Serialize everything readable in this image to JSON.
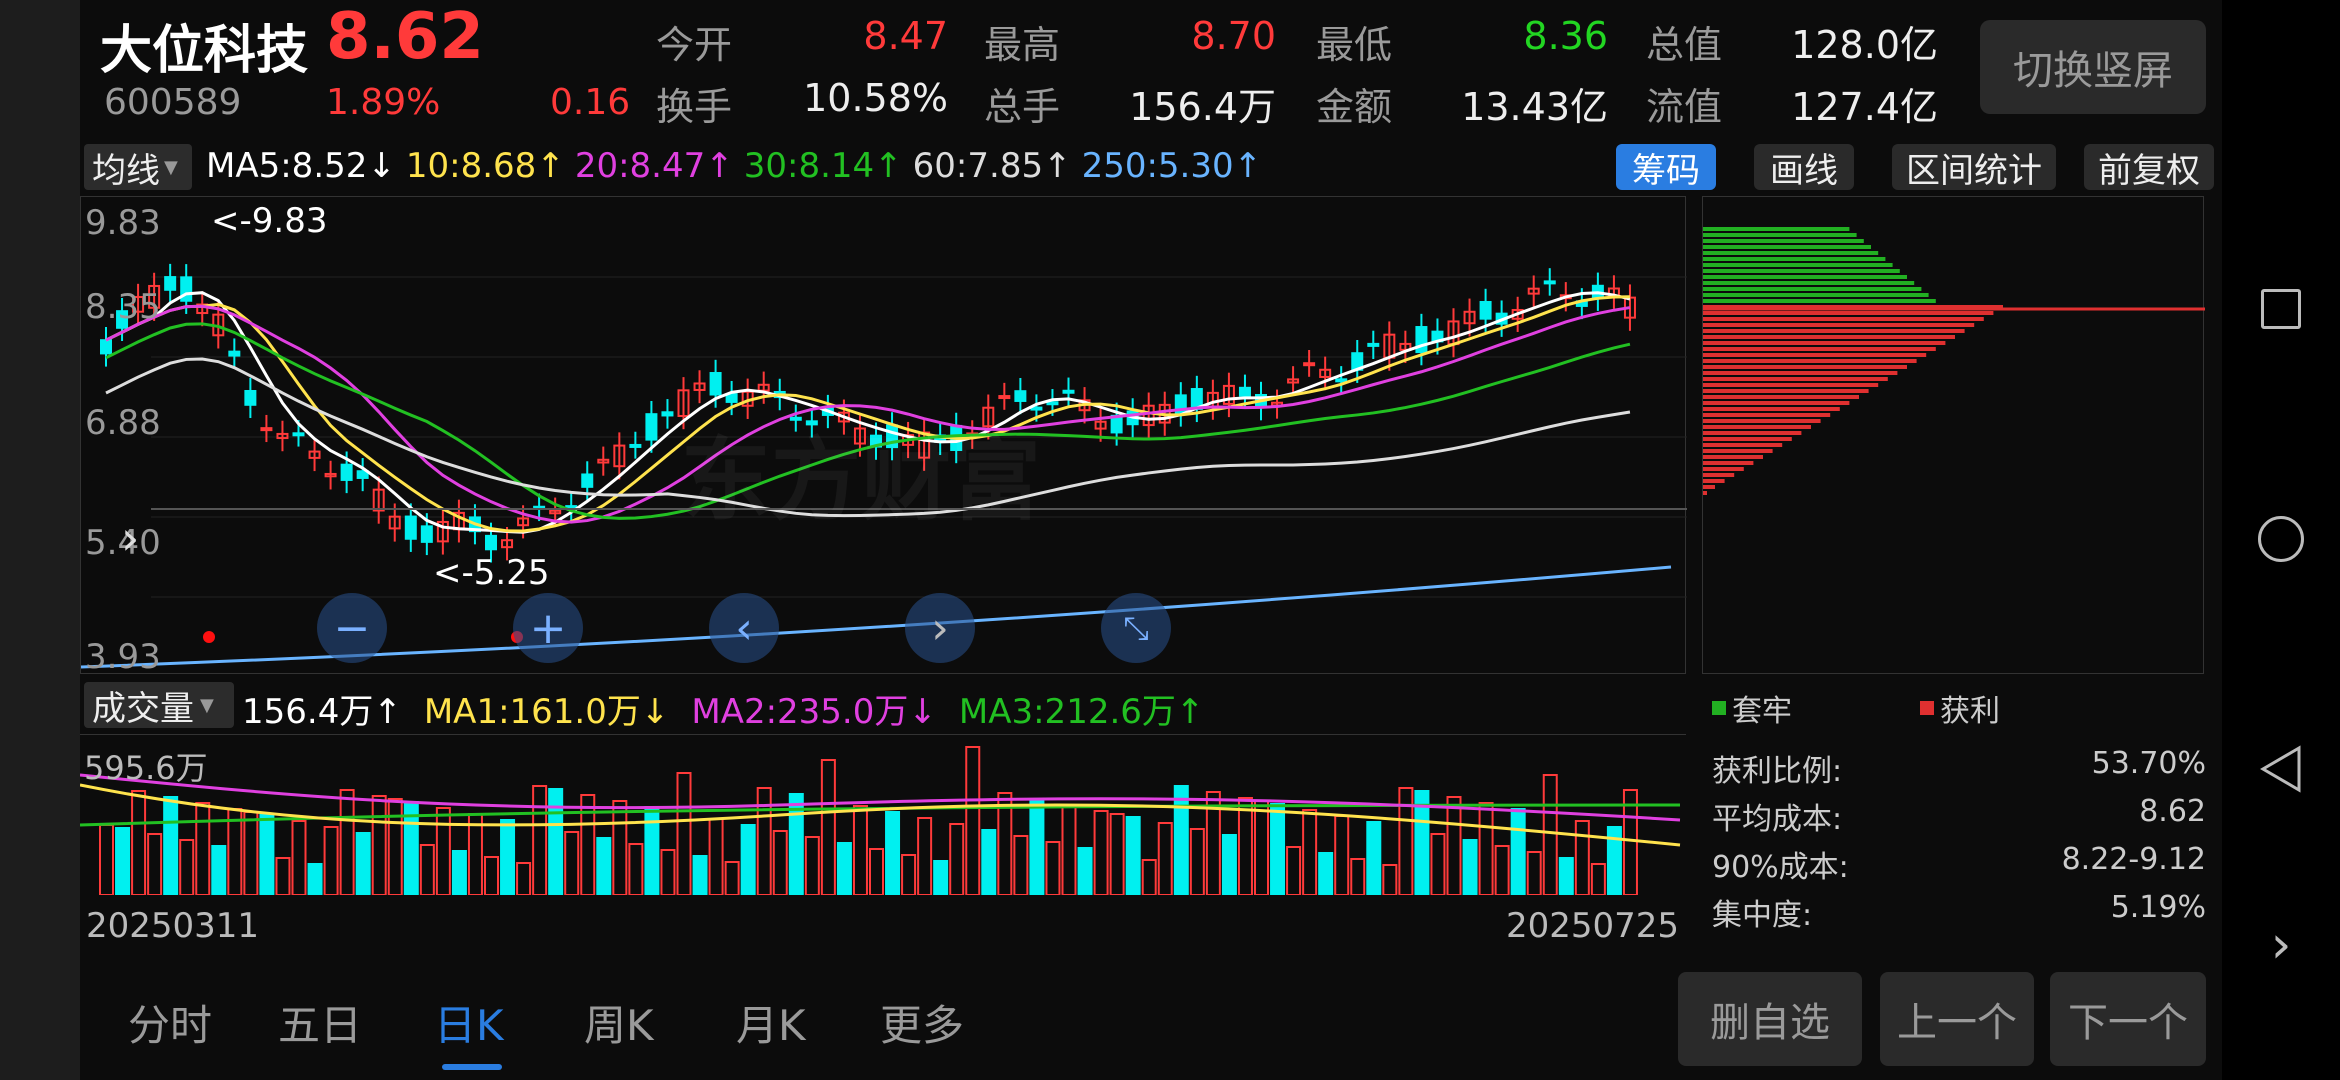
{
  "header": {
    "name": "大位科技",
    "price": "8.62",
    "code": "600589",
    "pct": "1.89%",
    "change": "0.16"
  },
  "stats": [
    {
      "label": "今开",
      "value": "8.47",
      "color": "red"
    },
    {
      "label": "最高",
      "value": "8.70",
      "color": "red"
    },
    {
      "label": "最低",
      "value": "8.36",
      "color": "green"
    },
    {
      "label": "总值",
      "value": "128.0亿",
      "color": "white"
    },
    {
      "label": "换手",
      "value": "10.58%",
      "color": "white"
    },
    {
      "label": "总手",
      "value": "156.4万",
      "color": "white"
    },
    {
      "label": "金额",
      "value": "13.43亿",
      "color": "white"
    },
    {
      "label": "流值",
      "value": "127.4亿",
      "color": "white"
    }
  ],
  "switch_label": "切换竖屏",
  "ma": {
    "selector": "均线",
    "items": [
      {
        "text": "MA5:8.52",
        "arrow": "↓",
        "color": "#ffffff"
      },
      {
        "text": "10:8.68",
        "arrow": "↑",
        "color": "#ffe34d"
      },
      {
        "text": "20:8.47",
        "arrow": "↑",
        "color": "#e040e0"
      },
      {
        "text": "30:8.14",
        "arrow": "↑",
        "color": "#22c022"
      },
      {
        "text": "60:7.85",
        "arrow": "↑",
        "color": "#dddddd"
      },
      {
        "text": "250:5.30",
        "arrow": "↑",
        "color": "#69b4ff"
      }
    ]
  },
  "tools": {
    "chips": "筹码",
    "draw": "画线",
    "range": "区间统计",
    "adjust": "前复权"
  },
  "kchart": {
    "yticks": [
      "9.83",
      "8.35",
      "6.88",
      "5.40",
      "3.93"
    ],
    "high_label": "<-9.83",
    "low_label": "<-5.25",
    "watermark": "东方财富"
  },
  "volume": {
    "selector": "成交量",
    "items": [
      {
        "text": "156.4万",
        "arrow": "↑",
        "color": "#ffffff"
      },
      {
        "text": "MA1:161.0万",
        "arrow": "↓",
        "color": "#ffe34d"
      },
      {
        "text": "MA2:235.0万",
        "arrow": "↓",
        "color": "#e040e0"
      },
      {
        "text": "MA3:212.6万",
        "arrow": "↑",
        "color": "#22c022"
      }
    ],
    "max_label": "595.6万",
    "date_start": "20250311",
    "date_end": "20250725"
  },
  "chips": {
    "legend_trapped": "套牢",
    "legend_profit": "获利",
    "rows": [
      {
        "label": "获利比例:",
        "value": "53.70%"
      },
      {
        "label": "平均成本:",
        "value": "8.62"
      },
      {
        "label": "90%成本:",
        "value": "8.22-9.12"
      },
      {
        "label": "集中度:",
        "value": "5.19%"
      }
    ]
  },
  "tabs": [
    "分时",
    "五日",
    "日K",
    "周K",
    "月K",
    "更多"
  ],
  "active_tab": "日K",
  "buttons": {
    "del": "删自选",
    "prev": "上一个",
    "next": "下一个"
  },
  "colors": {
    "up": "#ff3a3a",
    "down": "#00f0f0",
    "accent": "#2a7de1"
  }
}
